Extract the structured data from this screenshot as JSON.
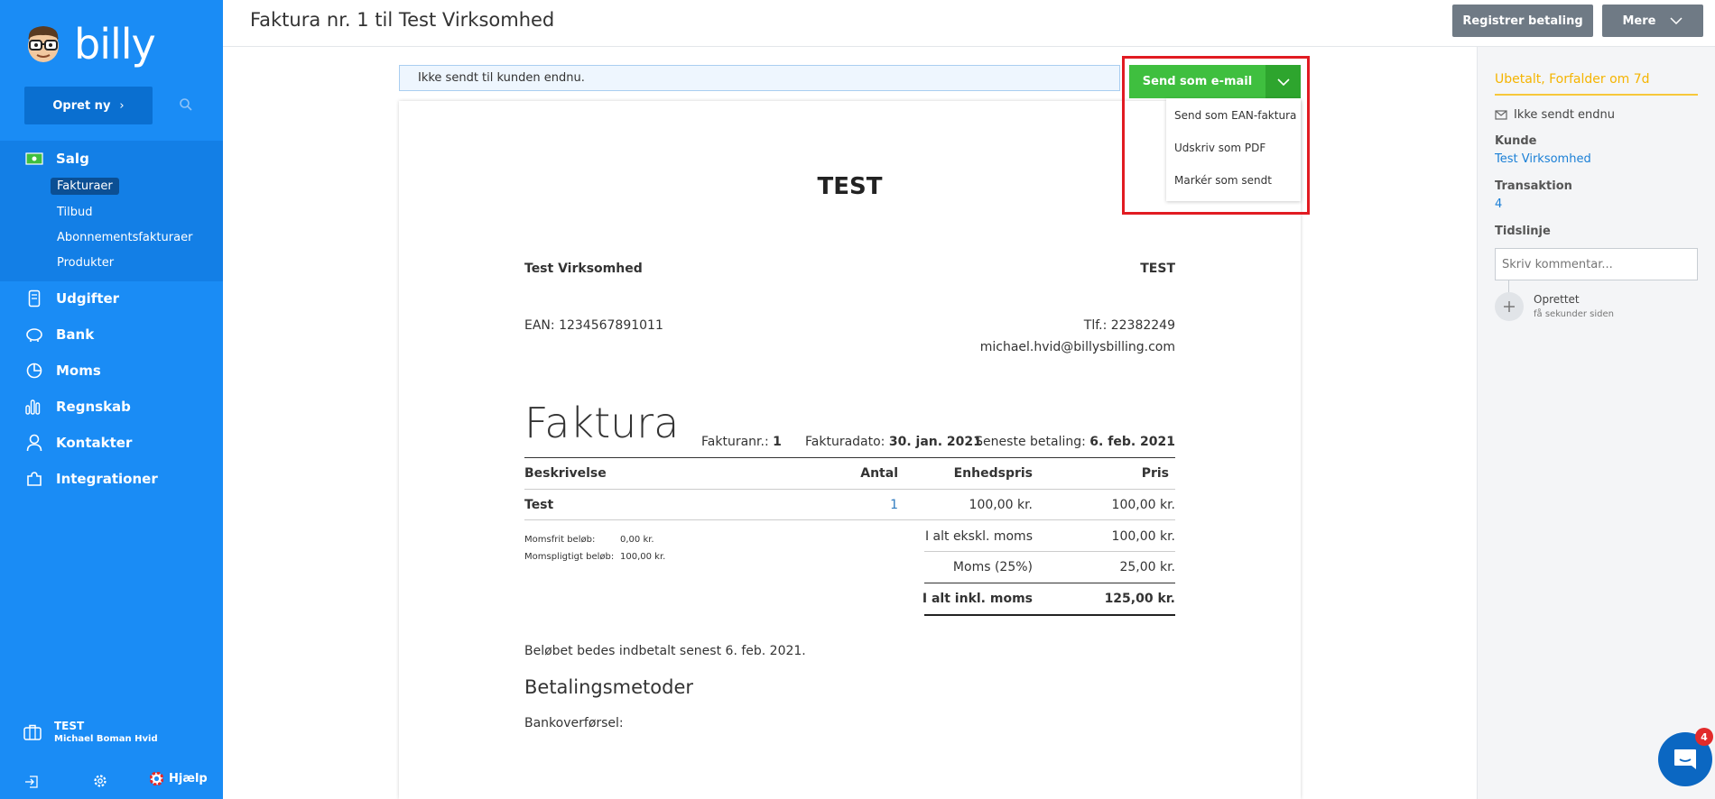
{
  "app": {
    "brand": "billy"
  },
  "sidebar": {
    "create_label": "Opret ny",
    "nav": [
      {
        "label": "Salg",
        "icon": "money-icon"
      },
      {
        "label": "Udgifter",
        "icon": "receipt-icon"
      },
      {
        "label": "Bank",
        "icon": "piggy-bank-icon"
      },
      {
        "label": "Moms",
        "icon": "pie-chart-icon"
      },
      {
        "label": "Regnskab",
        "icon": "bar-chart-icon"
      },
      {
        "label": "Kontakter",
        "icon": "person-icon"
      },
      {
        "label": "Integrationer",
        "icon": "puzzle-icon"
      }
    ],
    "sub": [
      "Fakturaer",
      "Tilbud",
      "Abonnementsfakturaer",
      "Produkter"
    ],
    "org_name": "TEST",
    "user_name": "Michael Boman Hvid",
    "help_label": "Hjælp"
  },
  "header": {
    "title": "Faktura nr. 1 til Test Virksomhed",
    "register_label": "Registrer betaling",
    "more_label": "Mere"
  },
  "notice": "Ikke sendt til kunden endnu.",
  "send": {
    "primary": "Send som e-mail",
    "menu": [
      "Send som EAN-faktura",
      "Udskriv som PDF",
      "Markér som sendt"
    ]
  },
  "invoice": {
    "company": "TEST",
    "customer": "Test Virksomhed",
    "seller": "TEST",
    "ean": "EAN: 1234567891011",
    "phone": "Tlf.: 22382249",
    "email": "michael.hvid@billysbilling.com",
    "heading": "Faktura",
    "number_label": "Fakturanr.:",
    "number": "1",
    "date_label": "Fakturadato:",
    "date": "30. jan. 2021",
    "due_label": "Seneste betaling:",
    "due": "6. feb. 2021",
    "columns": [
      "Beskrivelse",
      "Antal",
      "Enhedspris",
      "Pris"
    ],
    "lines": [
      {
        "desc": "Test",
        "qty": "1",
        "unit": "100,00 kr.",
        "price": "100,00 kr."
      }
    ],
    "exempt_label": "Momsfrit beløb:",
    "exempt_value": "0,00 kr.",
    "taxable_label": "Momspligtigt beløb:",
    "taxable_value": "100,00 kr.",
    "subtotal_label": "I alt ekskl. moms",
    "subtotal": "100,00 kr.",
    "vat_label": "Moms (25%)",
    "vat": "25,00 kr.",
    "total_label": "I alt inkl. moms",
    "total": "125,00 kr.",
    "pay_note": "Beløbet bedes indbetalt senest 6. feb. 2021.",
    "methods_heading": "Betalingsmetoder",
    "bank_label": "Bankoverførsel:"
  },
  "panel": {
    "status": "Ubetalt, Forfalder om 7d",
    "sent_status": "Ikke sendt endnu",
    "customer_label": "Kunde",
    "customer": "Test Virksomhed",
    "transaction_label": "Transaktion",
    "transaction": "4",
    "timeline_label": "Tidslinje",
    "comment_placeholder": "Skriv kommentar...",
    "event": "Oprettet",
    "event_time": "få sekunder siden"
  },
  "chat": {
    "badge": "4"
  },
  "colors": {
    "sidebar": "#1a8cf5",
    "send": "#3fbf3f",
    "status": "#f5b400",
    "highlight": "#e11b22"
  }
}
